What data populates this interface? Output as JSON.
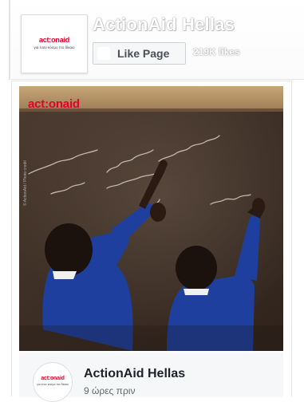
{
  "page": {
    "name": "ActionAid Hellas",
    "like_button_label": "Like Page",
    "likes": "219K likes",
    "logo": {
      "wordmark": "act:onaid",
      "tagline": "για έναν κόσμο πιο δίκαιο"
    }
  },
  "post": {
    "image": {
      "brand_mark": "act:onaid",
      "photo_credit": "© ActionAid / Photo credit"
    },
    "author": "ActionAid Hellas",
    "time": "9 ώρες πριν"
  },
  "icons": {
    "like_button_icon": "facebook-f-icon"
  },
  "colors": {
    "brand_red": "#e4002b",
    "chalkboard": "#3a2b22",
    "uniform_blue": "#1f3f9e",
    "facebook_blue": "#4267b2"
  }
}
